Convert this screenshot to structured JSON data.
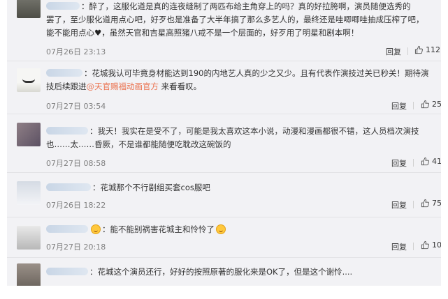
{
  "comments": [
    {
      "text_line1": "：醉了，这服化道是真的连夜缝制了两匹布给主角穿上的吗？真的好拉胯啊，演员随便选秀的",
      "text_line2": "罢了，至少服化道用点心吧，好歹也是准备了大半年搞了那么多艺人的，最终还是哇唧唧哇抽成压榨了吧，",
      "text_line3a": "能不能用点心",
      "heart": "♥",
      "text_line3b": "，虽然天官和吉星高照猪八戒不是一个层面的，好歹用了明星和剧本啊！",
      "time": "07月26日 23:13",
      "reply": "回复",
      "likes": "112"
    },
    {
      "text_line1": "：花城我认可毕竟身材能达到190的内地艺人真的少之又少。且有代表作演技过关已秒关！期待演",
      "text_line2a": "技后续跟进",
      "link": "@天官赐福动画官方",
      "text_line2b": " 来看看叹。",
      "time": "07月27日 03:54",
      "reply": "回复",
      "likes": "25"
    },
    {
      "text_line1": "：我天！我实在是受不了，可能是我太喜欢这本小说，动漫和漫画都很不错，这人员档次演技",
      "text_line2": "也……太……昏厥，不是谁都能随便吃耽改这碗饭的",
      "time": "07月27日 08:58",
      "reply": "回复",
      "likes": "41"
    },
    {
      "text_line1": "：花城那个不行剧组买套cos服吧",
      "time": "07月26日 18:22",
      "reply": "回复",
      "likes": "75"
    },
    {
      "text_line1": "：能不能别祸害花城主和怜怜了",
      "time": "07月27日 20:18",
      "reply": "回复",
      "likes": "10"
    },
    {
      "text_line1": "：花城这个演员还行，好好的按照原著的服化来是OK了，但是这个谢怜...."
    }
  ]
}
